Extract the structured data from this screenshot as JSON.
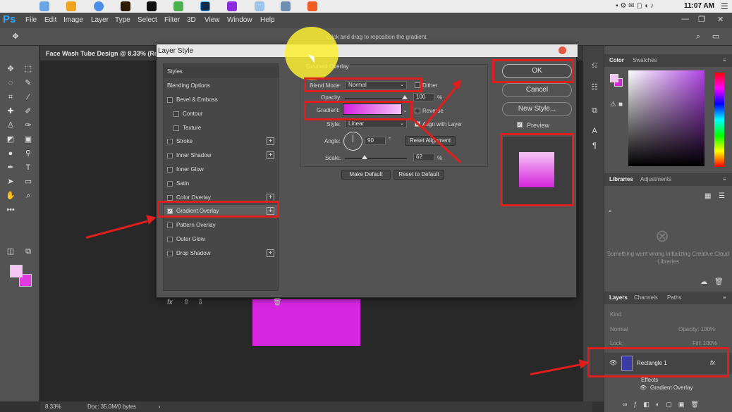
{
  "menubar": {
    "time": "11:07 AM"
  },
  "app": {
    "logo": "Ps",
    "menu": [
      "File",
      "Edit",
      "Image",
      "Layer",
      "Type",
      "Select",
      "Filter",
      "3D",
      "View",
      "Window",
      "Help"
    ],
    "options_hint": "Click and drag to reposition the gradient."
  },
  "document": {
    "tab_title": "Face Wash Tube Design @ 8.33% (Rect",
    "zoom": "8.33%",
    "doc_info": "Doc: 35.0M/0 bytes"
  },
  "dialog": {
    "title": "Layer Style",
    "styles_header": "Styles",
    "blending_options": "Blending Options",
    "items": [
      {
        "label": "Bevel & Emboss",
        "checked": false,
        "plus": false
      },
      {
        "label": "Contour",
        "checked": false,
        "plus": false,
        "sub": true
      },
      {
        "label": "Texture",
        "checked": false,
        "plus": false,
        "sub": true
      },
      {
        "label": "Stroke",
        "checked": false,
        "plus": true
      },
      {
        "label": "Inner Shadow",
        "checked": false,
        "plus": true
      },
      {
        "label": "Inner Glow",
        "checked": false,
        "plus": false
      },
      {
        "label": "Satin",
        "checked": false,
        "plus": false
      },
      {
        "label": "Color Overlay",
        "checked": false,
        "plus": true
      },
      {
        "label": "Gradient Overlay",
        "checked": true,
        "plus": true
      },
      {
        "label": "Pattern Overlay",
        "checked": false,
        "plus": false
      },
      {
        "label": "Outer Glow",
        "checked": false,
        "plus": false
      },
      {
        "label": "Drop Shadow",
        "checked": false,
        "plus": true
      }
    ],
    "fx": "fx",
    "section_title": "Gradient Overlay",
    "blend_mode_label": "Blend Mode:",
    "blend_mode_value": "Normal",
    "dither": "Dither",
    "opacity_label": "Opacity:",
    "opacity_value": "100",
    "opacity_unit": "%",
    "gradient_label": "Gradient:",
    "reverse": "Reverse",
    "style_label": "Style:",
    "style_value": "Linear",
    "align_with_layer": "Align with Layer",
    "angle_label": "Angle:",
    "angle_value": "90",
    "angle_unit": "°",
    "reset_alignment": "Reset Alignment",
    "scale_label": "Scale:",
    "scale_value": "62",
    "scale_unit": "%",
    "make_default": "Make Default",
    "reset_to_default": "Reset to Default",
    "ok": "OK",
    "cancel": "Cancel",
    "new_style": "New Style...",
    "preview": "Preview"
  },
  "panels": {
    "color_tabs": [
      "Color",
      "Swatches"
    ],
    "library_tabs": [
      "Libraries",
      "Adjustments"
    ],
    "library_message": "Something went wrong initializing Creative Cloud Libraries",
    "layer_tabs": [
      "Layers",
      "Channels",
      "Paths"
    ],
    "kind": "Kind",
    "blend": "Normal",
    "opacity": "Opacity: 100%",
    "lock": "Lock:",
    "fill": "Fill: 100%",
    "layer_name": "Rectangle 1",
    "effects": "Effects",
    "effect_item": "Gradient Overlay"
  },
  "colors": {
    "annotation_red": "#e01e1e",
    "gradient_start": "#d51fdd",
    "gradient_end": "#f5c6f7",
    "highlight_yellow": "#faee32"
  }
}
